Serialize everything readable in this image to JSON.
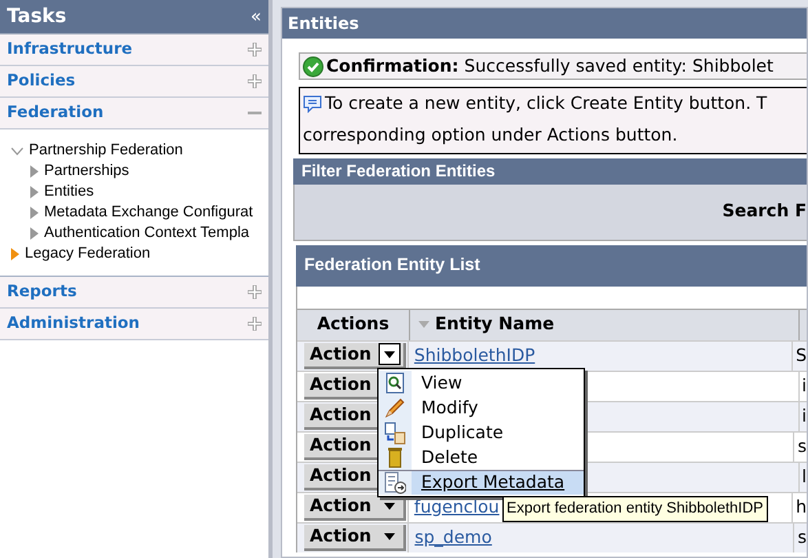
{
  "sidebar": {
    "title": "Tasks",
    "collapse_glyph": "«",
    "sections": [
      {
        "label": "Infrastructure",
        "expanded": false
      },
      {
        "label": "Policies",
        "expanded": false
      },
      {
        "label": "Federation",
        "expanded": true,
        "children": [
          {
            "label": "Partnership Federation",
            "expanded": true,
            "selected": false,
            "children": [
              {
                "label": "Partnerships",
                "expanded": false,
                "selected": false
              },
              {
                "label": "Entities",
                "expanded": false,
                "selected": false
              },
              {
                "label": "Metadata Exchange Configurat",
                "expanded": false,
                "selected": false
              },
              {
                "label": "Authentication Context Templa",
                "expanded": false,
                "selected": false
              }
            ]
          },
          {
            "label": "Legacy Federation",
            "expanded": false,
            "selected": true
          }
        ]
      },
      {
        "label": "Reports",
        "expanded": false
      },
      {
        "label": "Administration",
        "expanded": false
      }
    ]
  },
  "main": {
    "title": "Entities",
    "confirmation": {
      "label": "Confirmation:",
      "text": "Successfully saved entity: Shibbolet"
    },
    "info": {
      "text": "To create a new entity, click Create Entity button. T",
      "text_2": "corresponding option under Actions button."
    },
    "filter": {
      "title": "Filter Federation Entities",
      "search_label": "Search F"
    },
    "list": {
      "title": "Federation Entity List",
      "columns": [
        "Actions",
        "Entity Name"
      ],
      "rows": [
        {
          "action": "Action",
          "open": true,
          "name": "ShibbolethIDP",
          "column_3": "S"
        },
        {
          "action": "Action",
          "column_3": "i"
        },
        {
          "action": "Action",
          "column_3": "i"
        },
        {
          "action": "Action",
          "column_3": "s"
        },
        {
          "action": "Action",
          "column_3": "l"
        },
        {
          "action": "Action",
          "open": false,
          "name": "fugenclou",
          "column_3": "h"
        },
        {
          "action": "Action",
          "open": false,
          "name": "sp_demo",
          "column_3": "s"
        }
      ]
    },
    "menu": [
      {
        "kind": "view",
        "label": "View",
        "selected": false
      },
      {
        "kind": "modify",
        "label": "Modify",
        "selected": false
      },
      {
        "kind": "duplicate",
        "label": "Duplicate",
        "selected": false
      },
      {
        "kind": "delete",
        "label": "Delete",
        "selected": false
      },
      {
        "kind": "export",
        "label": "Export Metadata",
        "selected": true
      }
    ],
    "tooltip": "Export federation entity ShibbolethIDP"
  }
}
